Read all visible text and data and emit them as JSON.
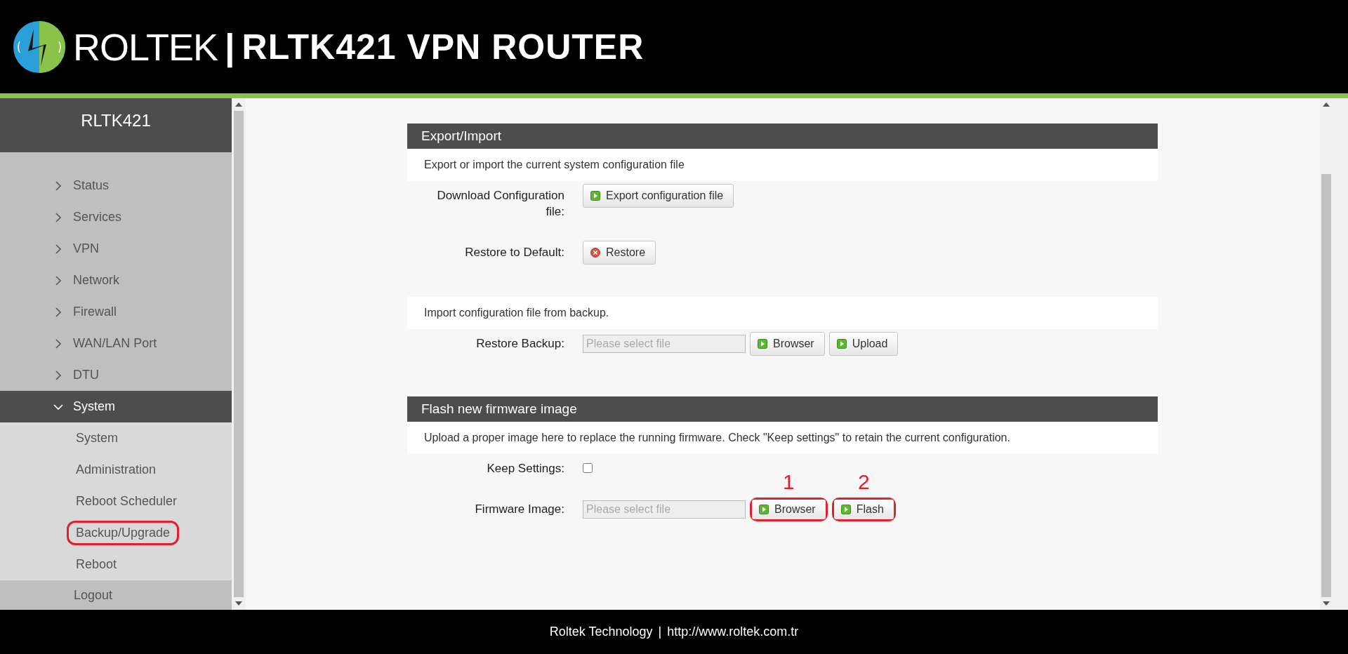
{
  "header": {
    "brand": "ROLTEK",
    "separator": "|",
    "title": "RLTK421 VPN ROUTER"
  },
  "sidebar": {
    "title": "RLTK421",
    "items": [
      {
        "label": "Status",
        "expanded": false,
        "selected": false
      },
      {
        "label": "Services",
        "expanded": false,
        "selected": false
      },
      {
        "label": "VPN",
        "expanded": false,
        "selected": false
      },
      {
        "label": "Network",
        "expanded": false,
        "selected": false
      },
      {
        "label": "Firewall",
        "expanded": false,
        "selected": false
      },
      {
        "label": "WAN/LAN Port",
        "expanded": false,
        "selected": false
      },
      {
        "label": "DTU",
        "expanded": false,
        "selected": false
      },
      {
        "label": "System",
        "expanded": true,
        "selected": true,
        "children": [
          {
            "label": "System",
            "highlighted": false
          },
          {
            "label": "Administration",
            "highlighted": false
          },
          {
            "label": "Reboot Scheduler",
            "highlighted": false
          },
          {
            "label": "Backup/Upgrade",
            "highlighted": true
          },
          {
            "label": "Reboot",
            "highlighted": false
          }
        ]
      }
    ],
    "logout": "Logout"
  },
  "sections": [
    {
      "title": "Export/Import",
      "groups": [
        {
          "description": "Export or import the current system configuration file",
          "rows": [
            {
              "label": "Download Configuration file:",
              "controls": [
                {
                  "kind": "button",
                  "label": "Export configuration file",
                  "highlighted": false
                }
              ]
            },
            {
              "label": "Restore to Default:",
              "controls": [
                {
                  "kind": "reset",
                  "label": "Restore",
                  "highlighted": false
                }
              ]
            }
          ]
        },
        {
          "description": "Import configuration file from backup.",
          "rows": [
            {
              "label": "Restore Backup:",
              "controls": [
                {
                  "kind": "file",
                  "placeholder": "Please select file"
                },
                {
                  "kind": "button",
                  "label": "Browser",
                  "highlighted": false
                },
                {
                  "kind": "button",
                  "label": "Upload",
                  "highlighted": false
                }
              ]
            }
          ]
        }
      ]
    },
    {
      "title": "Flash new firmware image",
      "groups": [
        {
          "description": "Upload a proper image here to replace the running firmware. Check \"Keep settings\" to retain the current configuration.",
          "rows": [
            {
              "label": "Keep Settings:",
              "controls": [
                {
                  "kind": "checkbox",
                  "checked": false
                }
              ]
            },
            {
              "label": "Firmware Image:",
              "controls": [
                {
                  "kind": "file",
                  "placeholder": "Please select file"
                },
                {
                  "kind": "button",
                  "label": "Browser",
                  "highlighted": true,
                  "callout": "1"
                },
                {
                  "kind": "button",
                  "label": "Flash",
                  "highlighted": true,
                  "callout": "2"
                }
              ]
            }
          ]
        }
      ]
    }
  ],
  "footer": {
    "company": "Roltek Technology",
    "separator": "|",
    "url": "http://www.roltek.com.tr"
  }
}
